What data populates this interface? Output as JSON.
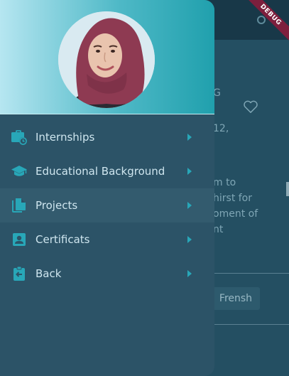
{
  "debug_banner": "DEBUG",
  "background": {
    "name_fragment": "G",
    "date_fragment": "12,",
    "description_fragment": "m to\nhirst for\noment of\nnt",
    "chip_label": "Frensh"
  },
  "drawer": {
    "menu": [
      {
        "id": "internships",
        "label": "Internships",
        "icon": "briefcase-clock-icon"
      },
      {
        "id": "education",
        "label": "Educational Background",
        "icon": "graduation-cap-icon"
      },
      {
        "id": "projects",
        "label": "Projects",
        "icon": "file-copy-icon",
        "selected": true
      },
      {
        "id": "certificates",
        "label": "Certificats",
        "icon": "account-box-icon"
      },
      {
        "id": "back",
        "label": "Back",
        "icon": "clipboard-back-icon"
      }
    ]
  },
  "colors": {
    "accent": "#20a0ad",
    "drawer_bg": "#2c5367",
    "icon": "#28a7b8",
    "label": "#cfe6ef",
    "hijab": "#8e3a52",
    "debug": "#7d1f3d"
  }
}
